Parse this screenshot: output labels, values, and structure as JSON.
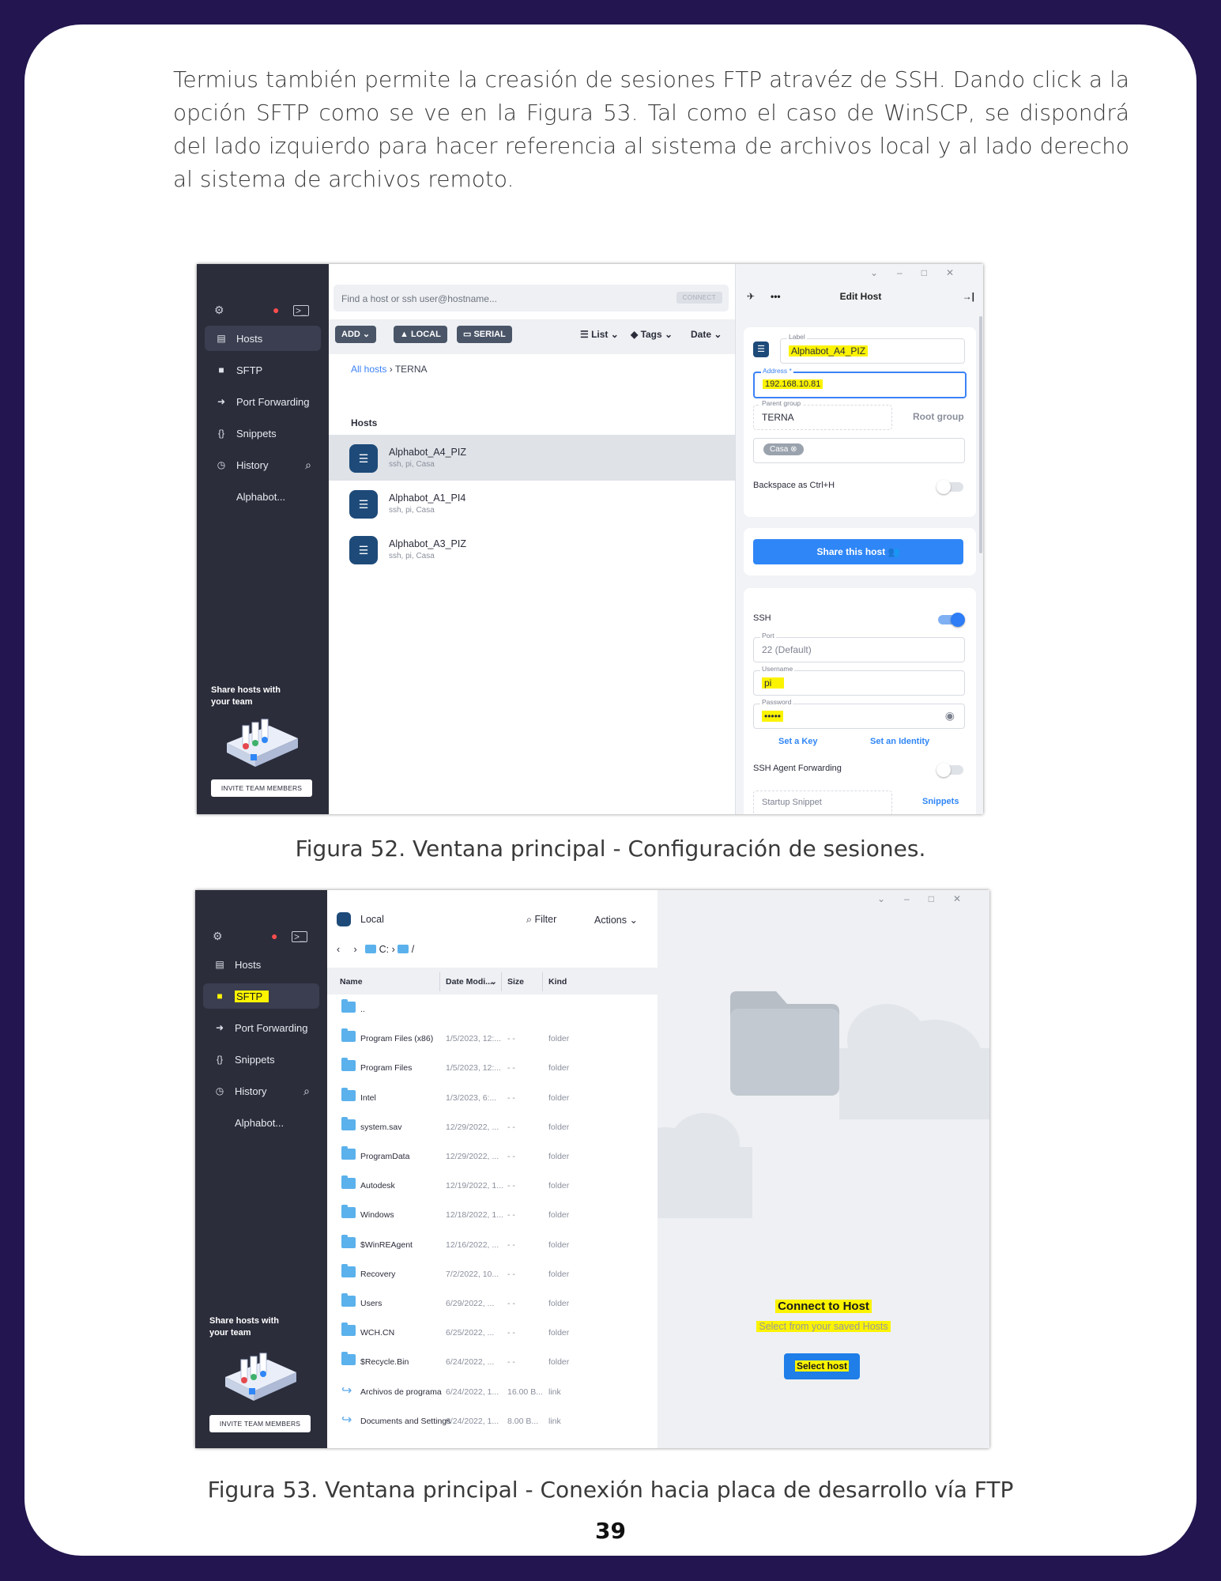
{
  "intro_text": "Termius también permite la creasión de sesiones FTP atravéz de SSH. Dando click a la opción SFTP como se ve en la Figura 53. Tal como el caso de WinSCP, se dispondrá del lado izquierdo para hacer referencia al sistema de archivos local y al lado derecho al sistema de archivos remoto.",
  "caption1": "Figura 52. Ventana principal - Configuración de sesiones.",
  "caption2": "Figura 53. Ventana principal - Conexión hacia placa de desarrollo vía FTP",
  "page_number": "39",
  "sidebar": {
    "items": [
      {
        "label": "Hosts",
        "icon": "hosts-icon"
      },
      {
        "label": "SFTP",
        "icon": "folder-icon"
      },
      {
        "label": "Port Forwarding",
        "icon": "arrow-icon"
      },
      {
        "label": "Snippets",
        "icon": "braces-icon"
      },
      {
        "label": "History",
        "icon": "clock-icon"
      },
      {
        "label": "Alphabot...",
        "icon": ""
      }
    ],
    "share_text": "Share hosts with your team",
    "invite_label": "INVITE TEAM MEMBERS"
  },
  "fig52": {
    "search_placeholder": "Find a host or ssh user@hostname...",
    "connect_label": "CONNECT",
    "toolbar": {
      "add": "ADD",
      "local": "LOCAL",
      "serial": "SERIAL",
      "list": "List",
      "tags": "Tags",
      "date": "Date"
    },
    "breadcrumb": {
      "root": "All hosts",
      "current": "TERNA"
    },
    "hosts_header": "Hosts",
    "hosts": [
      {
        "name": "Alphabot_A4_PIZ",
        "sub": "ssh, pi, Casa"
      },
      {
        "name": "Alphabot_A1_PI4",
        "sub": "ssh, pi, Casa"
      },
      {
        "name": "Alphabot_A3_PIZ",
        "sub": "ssh, pi, Casa"
      }
    ],
    "panel": {
      "title": "Edit Host",
      "label_caption": "Label",
      "label_value": "Alphabot_A4_PIZ",
      "address_caption": "Address *",
      "address_value": "192.168.10.81",
      "parent_caption": "Parent group",
      "parent_value": "TERNA",
      "root_group": "Root group",
      "tag": "Casa",
      "backspace": "Backspace as Ctrl+H",
      "share_btn": "Share this host",
      "ssh": "SSH",
      "port_caption": "Port",
      "port_value": "22 (Default)",
      "username_caption": "Username",
      "username_value": "pi",
      "password_caption": "Password",
      "password_value": "•••••",
      "set_key": "Set a Key",
      "set_identity": "Set an Identity",
      "agent_forwarding": "SSH Agent Forwarding",
      "startup_snippet": "Startup Snippet",
      "snippets_link": "Snippets"
    }
  },
  "fig53": {
    "local_label": "Local",
    "filter_label": "Filter",
    "actions_label": "Actions",
    "path": {
      "drive": "C:",
      "root": "/"
    },
    "columns": [
      "Name",
      "Date Modi...",
      "Size",
      "Kind"
    ],
    "files": [
      {
        "name": "..",
        "date": "",
        "size": "",
        "kind": "",
        "type": "folder"
      },
      {
        "name": "Program Files (x86)",
        "date": "1/5/2023, 12:...",
        "size": "- -",
        "kind": "folder",
        "type": "folder"
      },
      {
        "name": "Program Files",
        "date": "1/5/2023, 12:...",
        "size": "- -",
        "kind": "folder",
        "type": "folder"
      },
      {
        "name": "Intel",
        "date": "1/3/2023, 6:...",
        "size": "- -",
        "kind": "folder",
        "type": "folder"
      },
      {
        "name": "system.sav",
        "date": "12/29/2022, ...",
        "size": "- -",
        "kind": "folder",
        "type": "folder"
      },
      {
        "name": "ProgramData",
        "date": "12/29/2022, ...",
        "size": "- -",
        "kind": "folder",
        "type": "folder"
      },
      {
        "name": "Autodesk",
        "date": "12/19/2022, 1...",
        "size": "- -",
        "kind": "folder",
        "type": "folder"
      },
      {
        "name": "Windows",
        "date": "12/18/2022, 1...",
        "size": "- -",
        "kind": "folder",
        "type": "folder"
      },
      {
        "name": "$WinREAgent",
        "date": "12/16/2022, ...",
        "size": "- -",
        "kind": "folder",
        "type": "folder"
      },
      {
        "name": "Recovery",
        "date": "7/2/2022, 10...",
        "size": "- -",
        "kind": "folder",
        "type": "folder"
      },
      {
        "name": "Users",
        "date": "6/29/2022, ...",
        "size": "- -",
        "kind": "folder",
        "type": "folder"
      },
      {
        "name": "WCH.CN",
        "date": "6/25/2022, ...",
        "size": "- -",
        "kind": "folder",
        "type": "folder"
      },
      {
        "name": "$Recycle.Bin",
        "date": "6/24/2022, ...",
        "size": "- -",
        "kind": "folder",
        "type": "folder"
      },
      {
        "name": "Archivos de programa",
        "date": "6/24/2022, 1...",
        "size": "16.00 B...",
        "kind": "link",
        "type": "link"
      },
      {
        "name": "Documents and Settings",
        "date": "6/24/2022, 1...",
        "size": "8.00 B...",
        "kind": "link",
        "type": "link"
      }
    ],
    "connect_title": "Connect to Host",
    "connect_sub": "Select from your saved Hosts",
    "select_btn": "Select host"
  },
  "colors": {
    "background": "#23154f",
    "sidebar": "#2b2d3b",
    "accent": "#2f86f6",
    "highlight": "#fbf300"
  }
}
